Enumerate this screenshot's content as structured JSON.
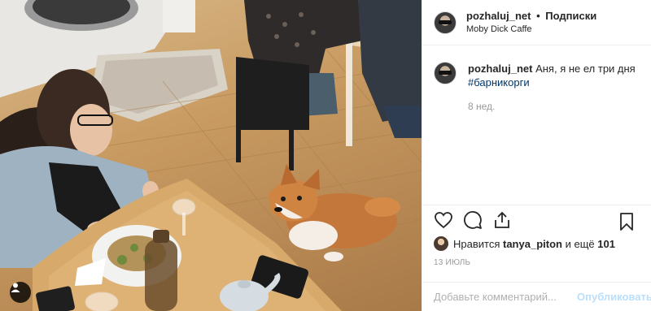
{
  "post": {
    "username": "pozhaluj_net",
    "separator": "•",
    "follow_label": "Подписки",
    "location": "Moby Dick Caffe",
    "caption_username": "pozhaluj_net",
    "caption_text": "Аня, я не ел три дня",
    "hashtag": "#барникорги",
    "caption_time": "8 нед.",
    "likes_prefix": "Нравится",
    "likes_user": "tanya_piton",
    "likes_suffix": "и ещё",
    "likes_count": "101",
    "date": "13 ИЮЛЬ"
  },
  "comment_box": {
    "placeholder": "Добавьте комментарий...",
    "publish_label": "Опубликовать"
  },
  "icons": {
    "like": "heart-icon",
    "comment": "comment-icon",
    "share": "share-icon",
    "save": "bookmark-icon",
    "tags": "user-tag-icon"
  },
  "colors": {
    "hashtag": "#003569",
    "muted": "#999999",
    "publish_disabled": "#b9dffc"
  }
}
